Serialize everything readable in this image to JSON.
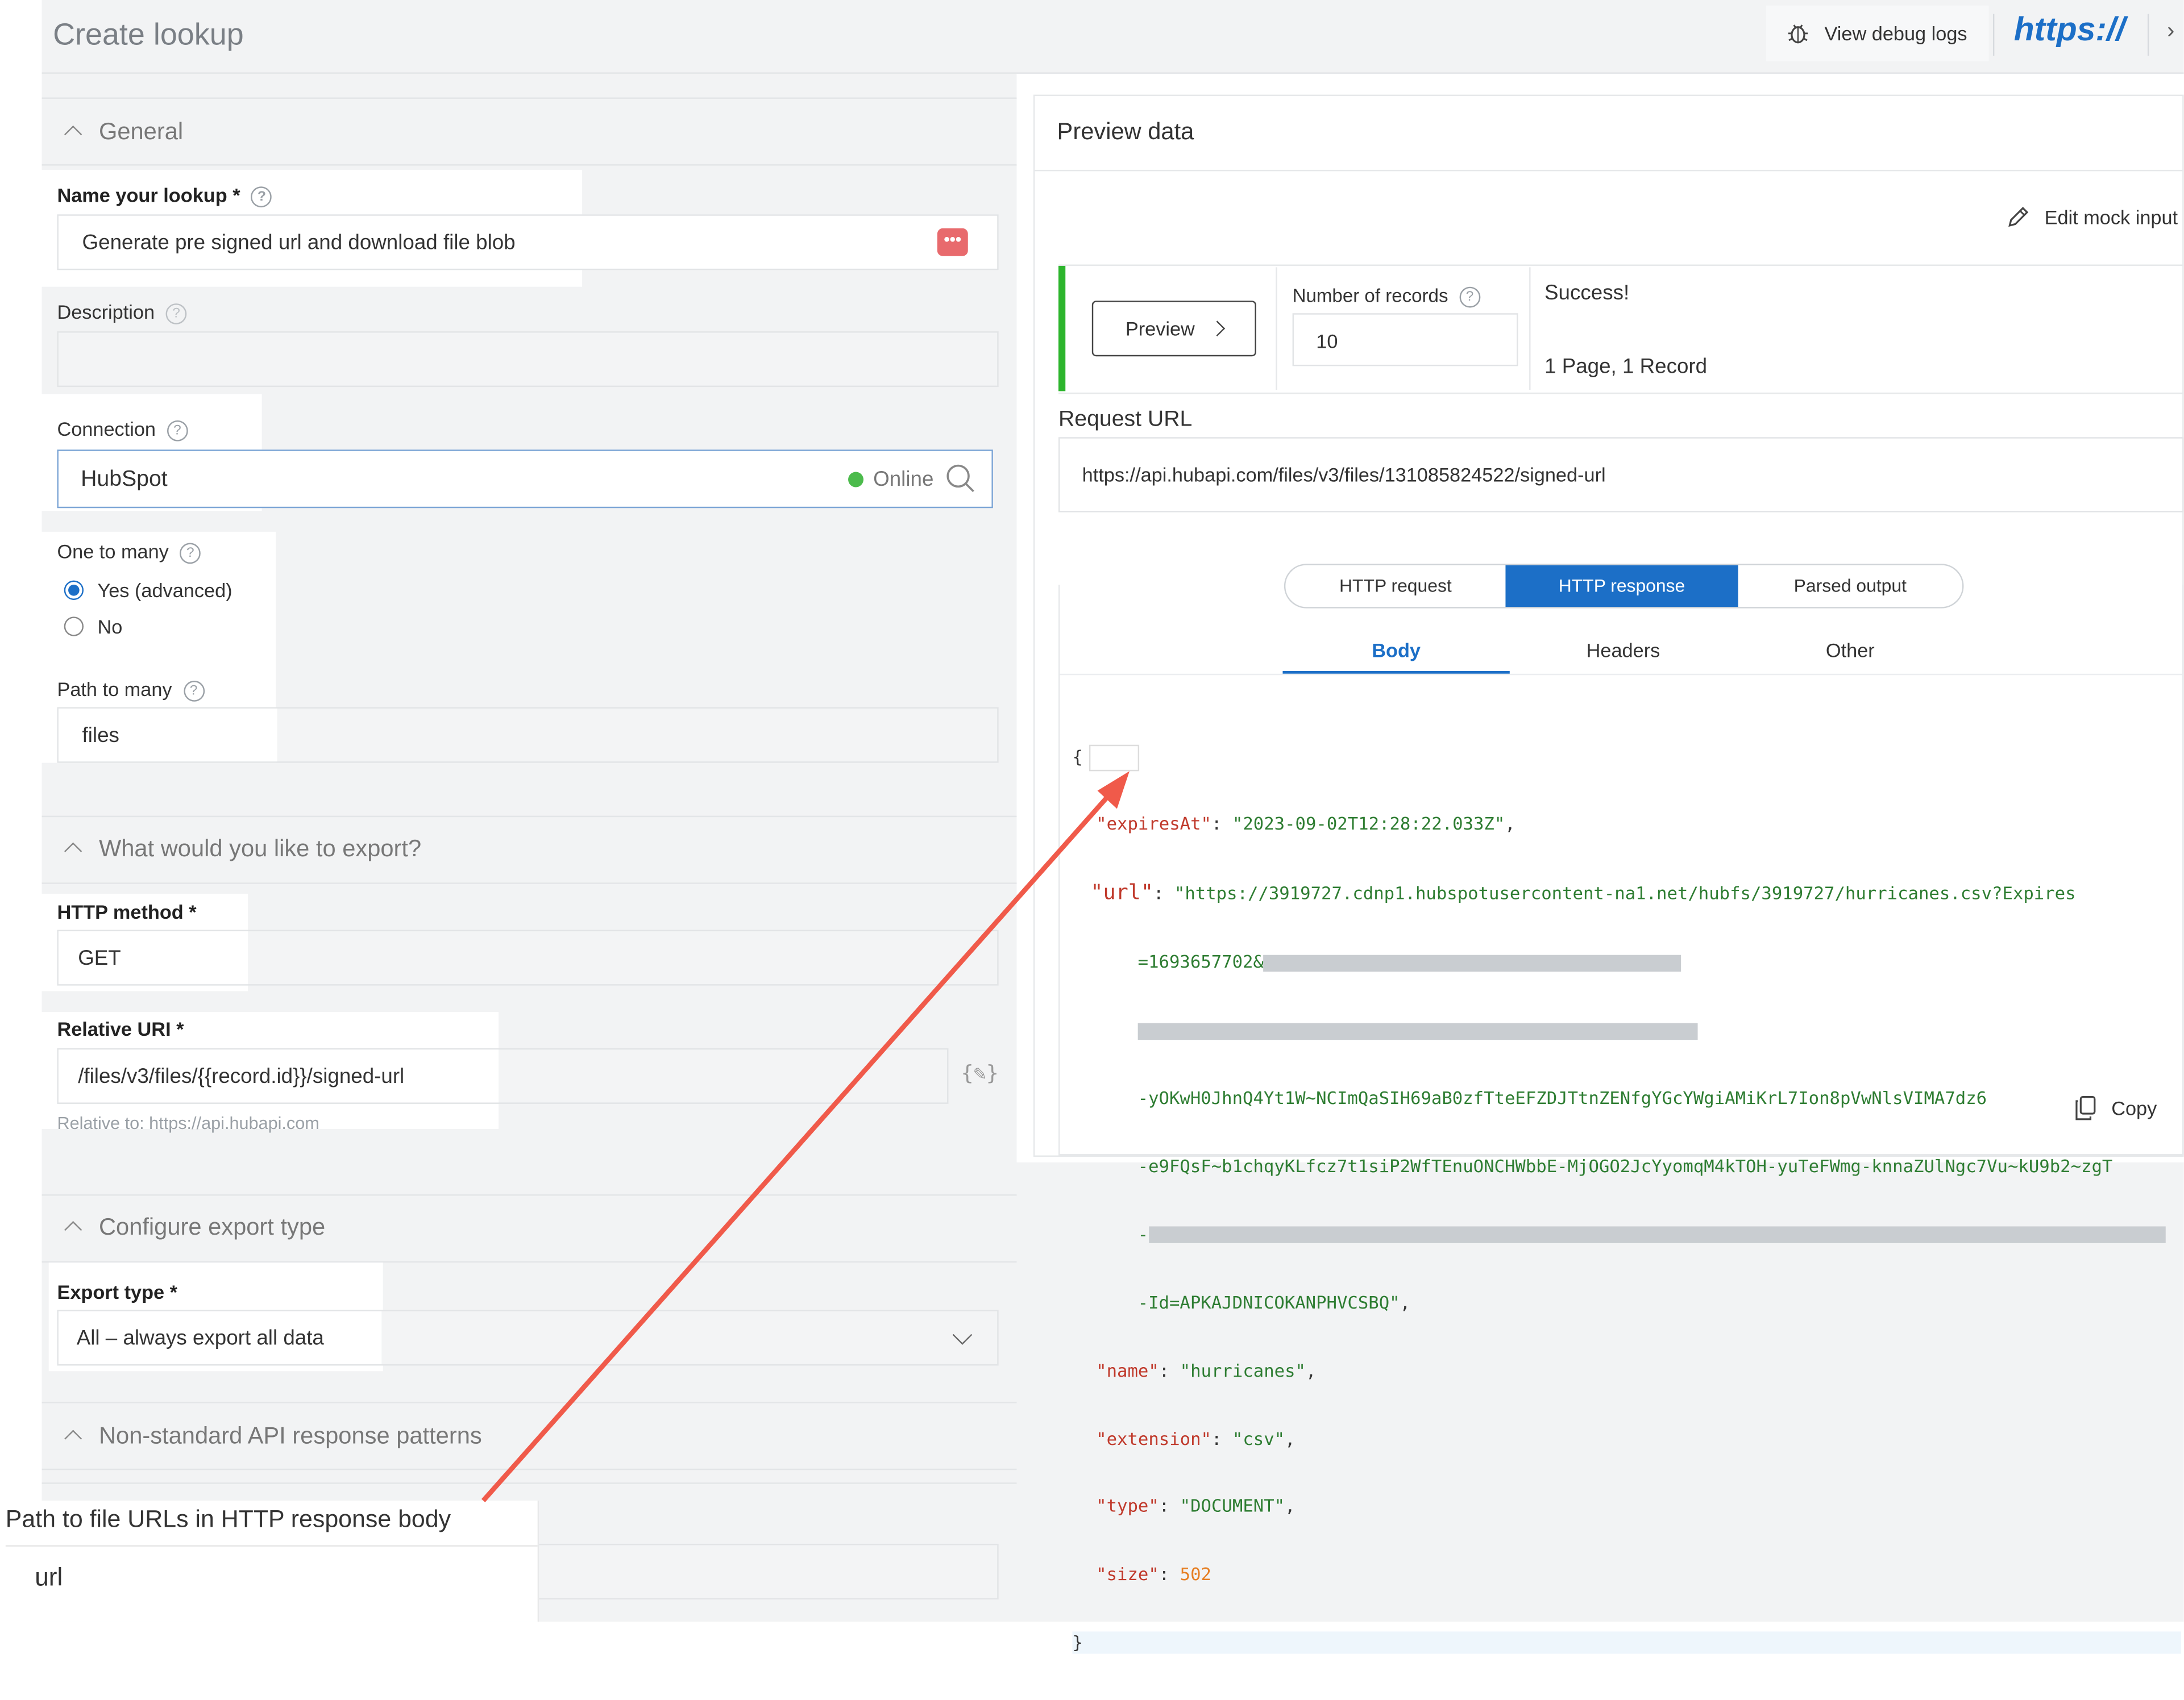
{
  "header": {
    "title": "Create lookup",
    "debug_label": "View debug logs",
    "https_label": "https://"
  },
  "general": {
    "section_label": "General",
    "name_label": "Name your lookup *",
    "name_value": "Generate pre signed url and download file blob",
    "description_label": "Description",
    "connection_label": "Connection",
    "connection_value": "HubSpot",
    "connection_status": "Online",
    "one_to_many_label": "One to many",
    "yes_option": "Yes (advanced)",
    "no_option": "No",
    "path_to_many_label": "Path to many",
    "path_to_many_value": "files"
  },
  "export": {
    "section_label": "What would you like to export?",
    "http_method_label": "HTTP method *",
    "http_method_value": "GET",
    "relative_uri_label": "Relative URI *",
    "relative_uri_value": "/files/v3/files/{{record.id}}/signed-url",
    "relative_to": "Relative to: https://api.hubapi.com"
  },
  "export_type": {
    "section_label": "Configure export type",
    "label": "Export type *",
    "value": "All – always export all data"
  },
  "nonstandard": {
    "section_label": "Non-standard API response patterns",
    "path_label": "Path to file URLs in HTTP response body",
    "path_value": "url"
  },
  "preview": {
    "title": "Preview data",
    "edit_mock": "Edit mock input",
    "preview_button": "Preview",
    "records_label": "Number of records",
    "records_value": "10",
    "success": "Success!",
    "summary": "1 Page, 1 Record",
    "request_url_label": "Request URL",
    "request_url": "https://api.hubapi.com/files/v3/files/131085824522/signed-url",
    "tabs": [
      "HTTP request",
      "HTTP response",
      "Parsed output"
    ],
    "subtabs": [
      "Body",
      "Headers",
      "Other"
    ],
    "copy": "Copy"
  },
  "json_body": {
    "open": "{",
    "close": "}",
    "expires_key": "\"expiresAt\"",
    "expires_val": "\"2023-09-02T12:28:22.033Z\"",
    "url_key": "\"url\"",
    "url_val_1": "\"https://3919727.cdnp1.hubspotusercontent-na1.net/hubfs/3919727/hurricanes.csv?Expires",
    "url_val_2": "=1693657702&",
    "url_val_4": "-yOKwH0JhnQ4Yt1W~NCImQaSIH69aB0zfTteEFZDJTtnZENfgYGcYWgiAMiKrL7Ion8pVwNlsVIMA7dz6",
    "url_val_5": "-e9FQsF~b1chqyKLfcz7t1siP2WfTEnuONCHWbbE-MjOGO2JcYyomqM4kTOH-yuTeFWmg-knnaZUlNgc7Vu~kU9b2~zgT",
    "url_val_7": "-Id=APKAJDNICOKANPHVCSBQ\"",
    "name_key": "\"name\"",
    "name_val": "\"hurricanes\"",
    "ext_key": "\"extension\"",
    "ext_val": "\"csv\"",
    "type_key": "\"type\"",
    "type_val": "\"DOCUMENT\"",
    "size_key": "\"size\"",
    "size_val": "502"
  },
  "colors": {
    "accent": "#1c6fc7",
    "success": "#2db52d",
    "status_online": "#4cbb4c",
    "arrow": "#f05a4a",
    "menu_badge": "#e5484d"
  }
}
